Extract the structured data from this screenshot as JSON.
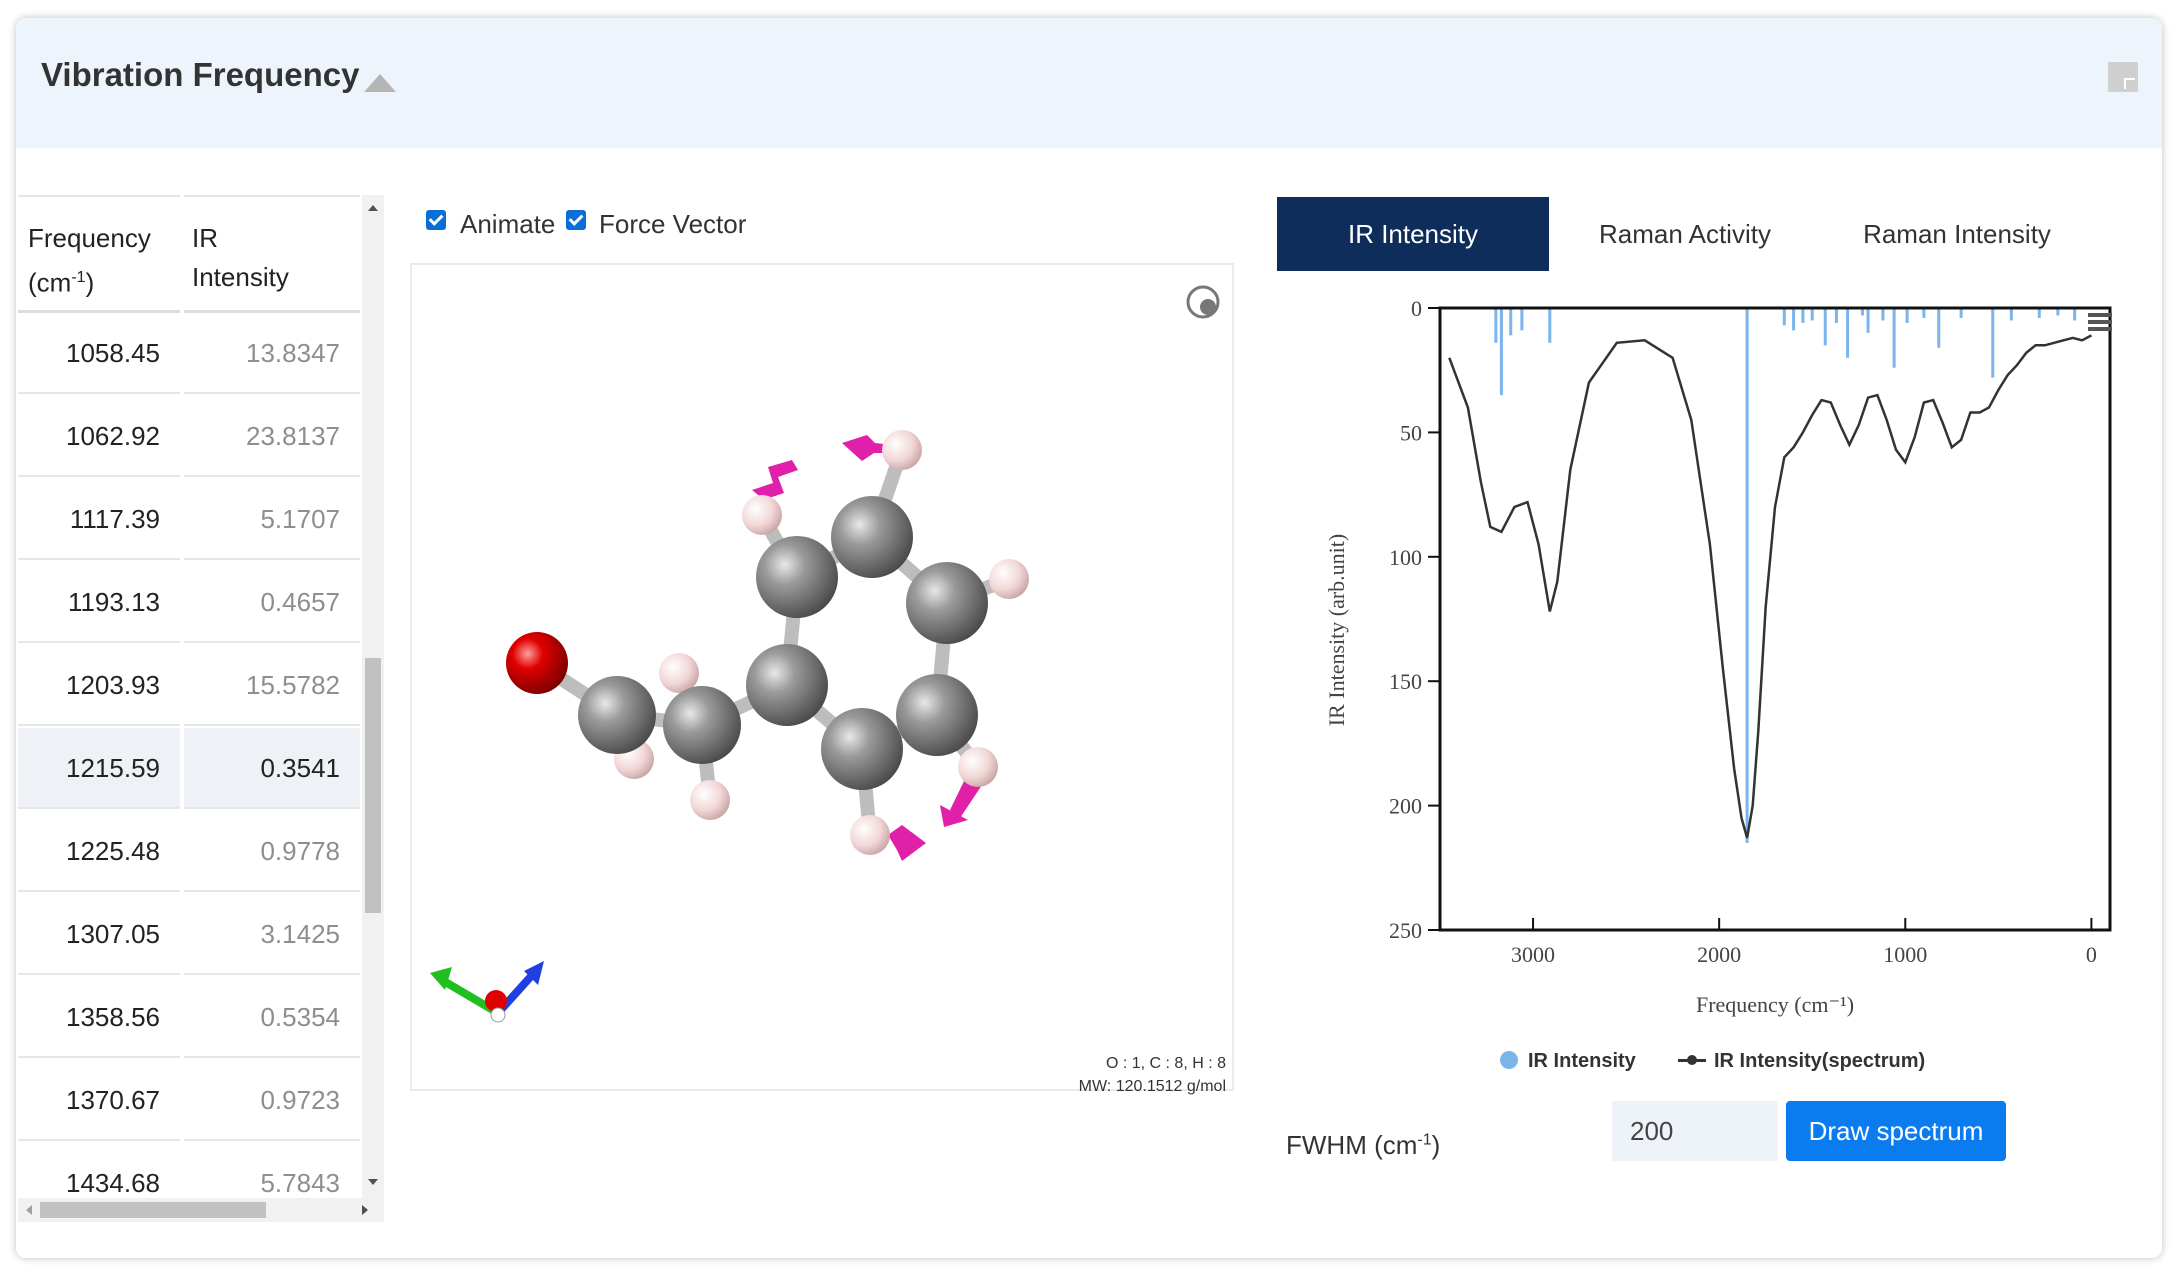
{
  "panel": {
    "title": "Vibration Frequency"
  },
  "table": {
    "col1_line1": "Frequency",
    "col1_line2": "(cm",
    "col1_sup": "-1",
    "col1_close": ")",
    "col2_line1": "IR",
    "col2_line2": "Intensity",
    "rows": [
      {
        "freq": "1058.45",
        "ir": "13.8347"
      },
      {
        "freq": "1062.92",
        "ir": "23.8137"
      },
      {
        "freq": "1117.39",
        "ir": "5.1707"
      },
      {
        "freq": "1193.13",
        "ir": "0.4657"
      },
      {
        "freq": "1203.93",
        "ir": "15.5782"
      },
      {
        "freq": "1215.59",
        "ir": "0.3541"
      },
      {
        "freq": "1225.48",
        "ir": "0.9778"
      },
      {
        "freq": "1307.05",
        "ir": "3.1425"
      },
      {
        "freq": "1358.56",
        "ir": "0.5354"
      },
      {
        "freq": "1370.67",
        "ir": "0.9723"
      },
      {
        "freq": "1434.68",
        "ir": "5.7843"
      }
    ],
    "selected_row": 5
  },
  "options": {
    "animate_label": "Animate",
    "animate_checked": true,
    "force_vector_label": "Force Vector",
    "force_vector_checked": true
  },
  "viewer": {
    "formula": "O : 1, C : 8, H : 8",
    "mw": "MW: 120.1512 g/mol"
  },
  "tabs": [
    {
      "label": "IR Intensity",
      "active": true
    },
    {
      "label": "Raman Activity",
      "active": false
    },
    {
      "label": "Raman Intensity",
      "active": false
    }
  ],
  "chart_data": {
    "type": "bar+line",
    "xlabel": "Frequency (cm⁻¹)",
    "ylabel": "IR Intensity (arb.unit)",
    "xlim": [
      3500,
      -100
    ],
    "ylim": [
      0,
      250
    ],
    "y_inverted": true,
    "x_ticks": [
      "3000",
      "2000",
      "1000",
      "0"
    ],
    "y_ticks": [
      "0",
      "50",
      "100",
      "150",
      "200",
      "250"
    ],
    "series": [
      {
        "name": "IR Intensity",
        "type": "bar",
        "color": "#7cb5ec",
        "x": [
          3200,
          3170,
          3120,
          3060,
          2910,
          1850,
          1650,
          1600,
          1550,
          1500,
          1430,
          1370,
          1310,
          1230,
          1200,
          1120,
          1060,
          990,
          900,
          820,
          700,
          530,
          430,
          280,
          180,
          90
        ],
        "values": [
          14,
          35,
          11,
          9,
          14,
          215,
          7,
          9,
          6,
          5,
          15,
          6,
          20,
          3,
          10,
          5,
          24,
          6,
          4,
          16,
          4,
          28,
          5,
          4,
          3,
          5
        ]
      },
      {
        "name": "IR Intensity(spectrum)",
        "type": "line",
        "color": "#333333",
        "x": [
          3450,
          3350,
          3280,
          3230,
          3170,
          3100,
          3030,
          2970,
          2910,
          2870,
          2800,
          2700,
          2550,
          2400,
          2250,
          2150,
          2050,
          1980,
          1920,
          1880,
          1850,
          1820,
          1790,
          1750,
          1700,
          1650,
          1600,
          1550,
          1500,
          1450,
          1400,
          1350,
          1300,
          1250,
          1200,
          1150,
          1100,
          1050,
          1000,
          950,
          900,
          850,
          800,
          750,
          700,
          650,
          600,
          550,
          500,
          450,
          400,
          350,
          300,
          250,
          200,
          150,
          100,
          50,
          0
        ],
        "values": [
          20,
          40,
          70,
          88,
          90,
          80,
          78,
          95,
          122,
          110,
          65,
          30,
          14,
          13,
          20,
          45,
          95,
          145,
          185,
          205,
          213,
          200,
          170,
          120,
          80,
          60,
          56,
          50,
          43,
          37,
          38,
          47,
          55,
          47,
          36,
          35,
          45,
          57,
          62,
          52,
          38,
          37,
          46,
          56,
          53,
          42,
          42,
          40,
          33,
          27,
          23,
          18,
          15,
          15,
          14,
          13,
          12,
          13,
          11
        ]
      }
    ],
    "legend": [
      "IR Intensity",
      "IR Intensity(spectrum)"
    ],
    "legend_position": "bottom"
  },
  "controls": {
    "fwhm_label": "FWHM (cm",
    "fwhm_sup": "-1",
    "fwhm_close": ")",
    "fwhm_value": "200",
    "draw_button": "Draw spectrum"
  }
}
